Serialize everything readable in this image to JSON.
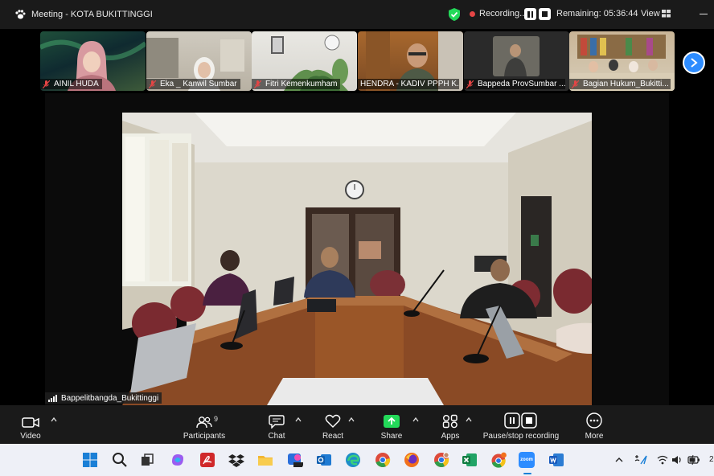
{
  "window": {
    "title": "Meeting - KOTA BUKITTINGGI",
    "recording_label": "Recording...",
    "remaining": "Remaining: 05:36:44",
    "view_label": "View"
  },
  "gallery": {
    "participants": [
      {
        "name": "AINIL HUDA"
      },
      {
        "name": "Eka _ Kanwil Sumbar"
      },
      {
        "name": "Fitri Kemenkumham"
      },
      {
        "name": "HENDRA - KADIV PPPH K..."
      },
      {
        "name": "Bappeda ProvSumbar ..."
      },
      {
        "name": "Bagian Hukum_Bukitti..."
      }
    ]
  },
  "stage": {
    "speaker_name": "Bappelitbangda_Bukittinggi"
  },
  "toolbar": {
    "video": "Video",
    "participants": "Participants",
    "participants_count": "9",
    "chat": "Chat",
    "react": "React",
    "share": "Share",
    "apps": "Apps",
    "pause_stop": "Pause/stop recording",
    "more": "More"
  },
  "colors": {
    "zoom_blue": "#2d8cff",
    "share_green": "#23d959",
    "recording_red": "#e54545",
    "taskbar_bg": "#eef0f7"
  },
  "taskbar": {
    "icons": [
      "windows-start-icon",
      "search-icon",
      "task-view-icon",
      "copilot-icon",
      "pdf-reader-icon",
      "dropbox-icon",
      "file-explorer-icon",
      "photos-icon",
      "outlook-icon",
      "edge-icon",
      "chrome-icon",
      "firefox-icon",
      "chrome-profile-icon",
      "excel-icon",
      "chrome-notify-icon",
      "zoom-icon",
      "word-icon"
    ],
    "zoom_label": "zoom",
    "clock_partial": "2"
  }
}
